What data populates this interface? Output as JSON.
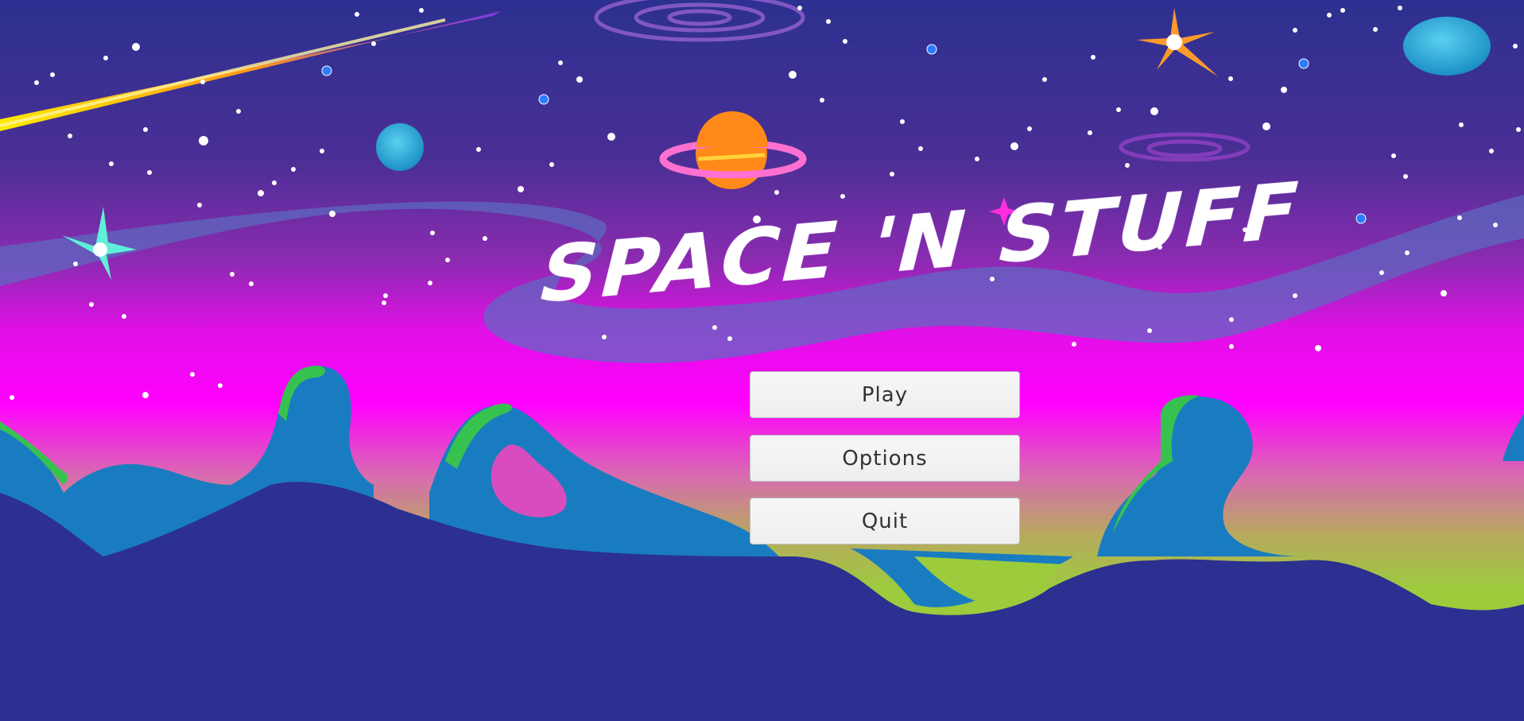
{
  "game": {
    "title": "Space 'n Stuff"
  },
  "menu": {
    "play_label": "Play",
    "options_label": "Options",
    "quit_label": "Quit"
  },
  "colors": {
    "sky_top": "#2c3090",
    "sky_magenta": "#ff00ff",
    "horizon_green": "#9ccc3c",
    "ground": "#2c3090",
    "button_face": "#f4f4f4",
    "button_text": "#333333"
  }
}
